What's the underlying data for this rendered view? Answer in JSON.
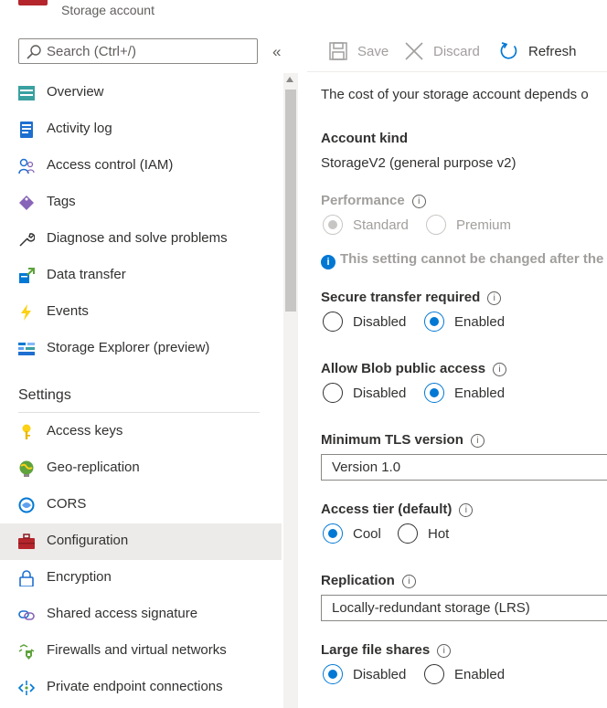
{
  "header": {
    "subtitle": "Storage account"
  },
  "search": {
    "placeholder": "Search (Ctrl+/)"
  },
  "collapse_glyph": "«",
  "nav_items": [
    {
      "label": "Overview",
      "icon": "overview-icon"
    },
    {
      "label": "Activity log",
      "icon": "activity-log-icon"
    },
    {
      "label": "Access control (IAM)",
      "icon": "people-icon"
    },
    {
      "label": "Tags",
      "icon": "tag-icon"
    },
    {
      "label": "Diagnose and solve problems",
      "icon": "wrench-icon"
    },
    {
      "label": "Data transfer",
      "icon": "data-transfer-icon"
    },
    {
      "label": "Events",
      "icon": "lightning-icon"
    },
    {
      "label": "Storage Explorer (preview)",
      "icon": "storage-explorer-icon"
    }
  ],
  "settings_section": {
    "title": "Settings",
    "items": [
      {
        "label": "Access keys",
        "icon": "key-icon"
      },
      {
        "label": "Geo-replication",
        "icon": "globe-icon"
      },
      {
        "label": "CORS",
        "icon": "cors-icon"
      },
      {
        "label": "Configuration",
        "icon": "toolbox-icon",
        "active": true
      },
      {
        "label": "Encryption",
        "icon": "lock-icon"
      },
      {
        "label": "Shared access signature",
        "icon": "link-icon"
      },
      {
        "label": "Firewalls and virtual networks",
        "icon": "firewall-icon"
      },
      {
        "label": "Private endpoint connections",
        "icon": "endpoint-icon"
      }
    ]
  },
  "toolbar": {
    "save": "Save",
    "discard": "Discard",
    "refresh": "Refresh"
  },
  "content": {
    "intro": "The cost of your storage account depends o",
    "account_kind": {
      "label": "Account kind",
      "value": "StorageV2 (general purpose v2)"
    },
    "performance": {
      "label": "Performance",
      "options": [
        "Standard",
        "Premium"
      ],
      "selected": "Standard"
    },
    "notice": "This setting cannot be changed after the",
    "secure_transfer": {
      "label": "Secure transfer required",
      "options": [
        "Disabled",
        "Enabled"
      ],
      "selected": "Enabled"
    },
    "blob_public": {
      "label": "Allow Blob public access",
      "options": [
        "Disabled",
        "Enabled"
      ],
      "selected": "Enabled"
    },
    "tls": {
      "label": "Minimum TLS version",
      "value": "Version 1.0"
    },
    "access_tier": {
      "label": "Access tier (default)",
      "options": [
        "Cool",
        "Hot"
      ],
      "selected": "Cool"
    },
    "replication": {
      "label": "Replication",
      "value": "Locally-redundant storage (LRS)"
    },
    "large_file_shares": {
      "label": "Large file shares",
      "options": [
        "Disabled",
        "Enabled"
      ],
      "selected": "Disabled"
    }
  },
  "colors": {
    "accent": "#0078d4",
    "active_nav_bg": "#edebe9",
    "disabled_text": "#a19f9d"
  }
}
